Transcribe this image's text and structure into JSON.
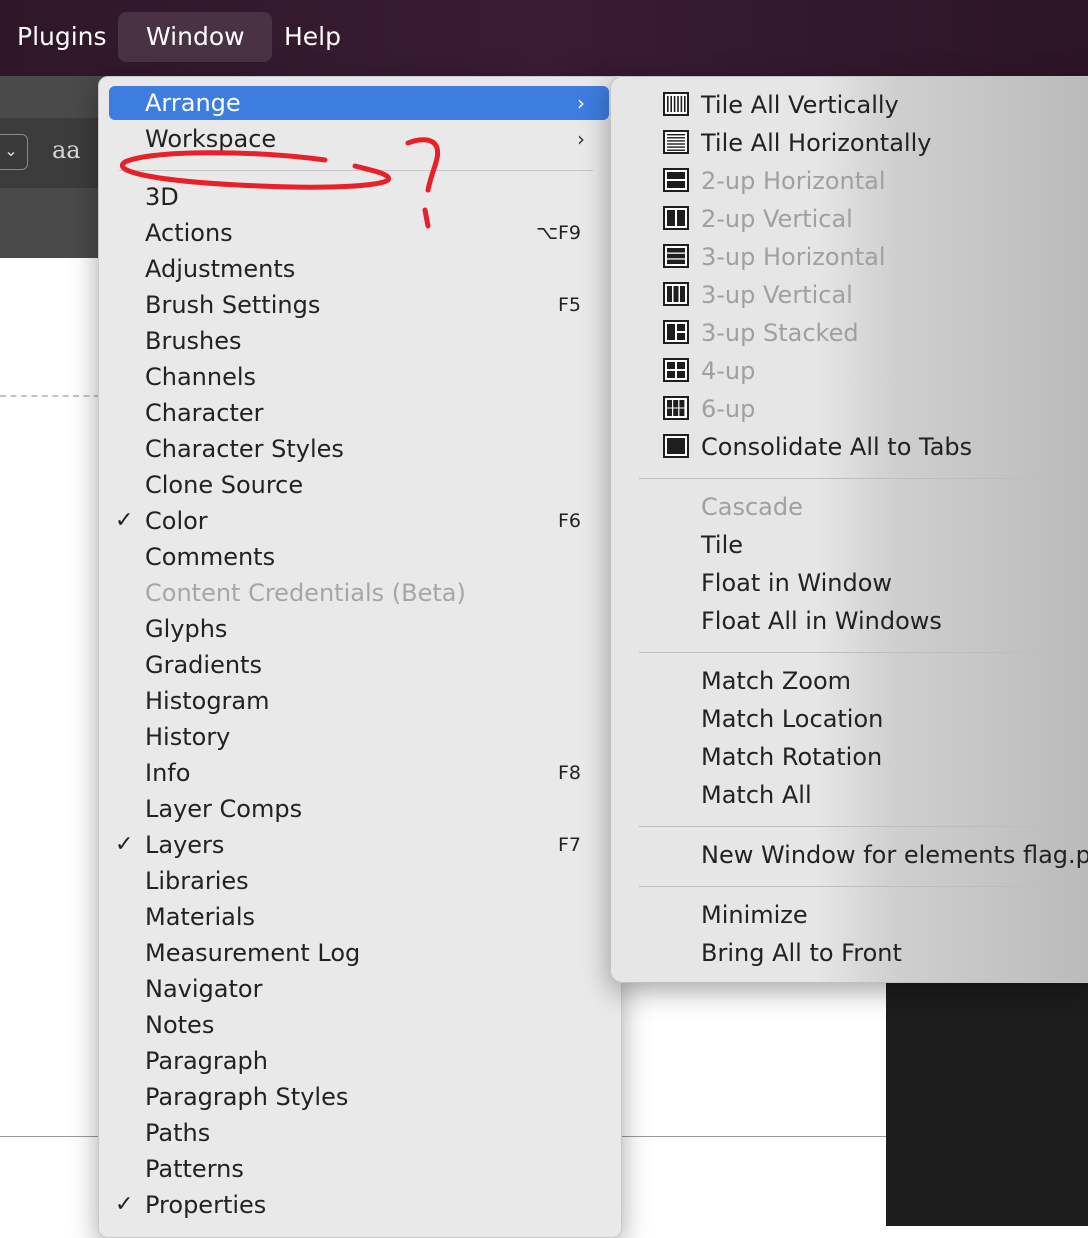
{
  "menubar": {
    "items": [
      {
        "label": "Plugins"
      },
      {
        "label": "Window"
      },
      {
        "label": "Help"
      }
    ]
  },
  "toolbar": {
    "select_chevron": "⌄",
    "aa_glyph": "aa"
  },
  "window_menu": {
    "items": [
      {
        "label": "Arrange",
        "submenu": true
      },
      {
        "label": "Workspace",
        "submenu": true
      },
      {
        "label": "3D"
      },
      {
        "label": "Actions",
        "shortcut": "⌥F9"
      },
      {
        "label": "Adjustments"
      },
      {
        "label": "Brush Settings",
        "shortcut": "F5"
      },
      {
        "label": "Brushes"
      },
      {
        "label": "Channels"
      },
      {
        "label": "Character"
      },
      {
        "label": "Character Styles"
      },
      {
        "label": "Clone Source"
      },
      {
        "label": "Color",
        "shortcut": "F6",
        "checked": true
      },
      {
        "label": "Comments"
      },
      {
        "label": "Content Credentials (Beta)",
        "disabled": true
      },
      {
        "label": "Glyphs"
      },
      {
        "label": "Gradients"
      },
      {
        "label": "Histogram"
      },
      {
        "label": "History"
      },
      {
        "label": "Info",
        "shortcut": "F8"
      },
      {
        "label": "Layer Comps"
      },
      {
        "label": "Layers",
        "shortcut": "F7",
        "checked": true
      },
      {
        "label": "Libraries"
      },
      {
        "label": "Materials"
      },
      {
        "label": "Measurement Log"
      },
      {
        "label": "Navigator"
      },
      {
        "label": "Notes"
      },
      {
        "label": "Paragraph"
      },
      {
        "label": "Paragraph Styles"
      },
      {
        "label": "Paths"
      },
      {
        "label": "Patterns"
      },
      {
        "label": "Properties",
        "checked": true
      }
    ],
    "submenu_arrow": "›",
    "check_mark": "✓"
  },
  "arrange_submenu": {
    "groups": [
      [
        {
          "label": "Tile All Vertically",
          "icon": "tile-vertical-icon"
        },
        {
          "label": "Tile All Horizontally",
          "icon": "tile-horizontal-icon"
        },
        {
          "label": "2-up Horizontal",
          "icon": "two-up-horizontal-icon",
          "disabled": true
        },
        {
          "label": "2-up Vertical",
          "icon": "two-up-vertical-icon",
          "disabled": true
        },
        {
          "label": "3-up Horizontal",
          "icon": "three-up-horizontal-icon",
          "disabled": true
        },
        {
          "label": "3-up Vertical",
          "icon": "three-up-vertical-icon",
          "disabled": true
        },
        {
          "label": "3-up Stacked",
          "icon": "three-up-stacked-icon",
          "disabled": true
        },
        {
          "label": "4-up",
          "icon": "four-up-icon",
          "disabled": true
        },
        {
          "label": "6-up",
          "icon": "six-up-icon",
          "disabled": true
        },
        {
          "label": "Consolidate All to Tabs",
          "icon": "consolidate-tabs-icon"
        }
      ],
      [
        {
          "label": "Cascade",
          "disabled": true
        },
        {
          "label": "Tile"
        },
        {
          "label": "Float in Window"
        },
        {
          "label": "Float All in Windows"
        }
      ],
      [
        {
          "label": "Match Zoom"
        },
        {
          "label": "Match Location"
        },
        {
          "label": "Match Rotation"
        },
        {
          "label": "Match All"
        }
      ],
      [
        {
          "label": "New Window for elements flag.p"
        }
      ],
      [
        {
          "label": "Minimize"
        },
        {
          "label": "Bring All to Front"
        }
      ]
    ]
  },
  "annotation": {
    "color": "#e8202a",
    "text": "?"
  },
  "colors": {
    "menubar_bg": "#3a1c33",
    "menu_highlight": "#3d7de0",
    "menu_bg": "#e9e9e9",
    "disabled_text": "#a6a6a6"
  }
}
